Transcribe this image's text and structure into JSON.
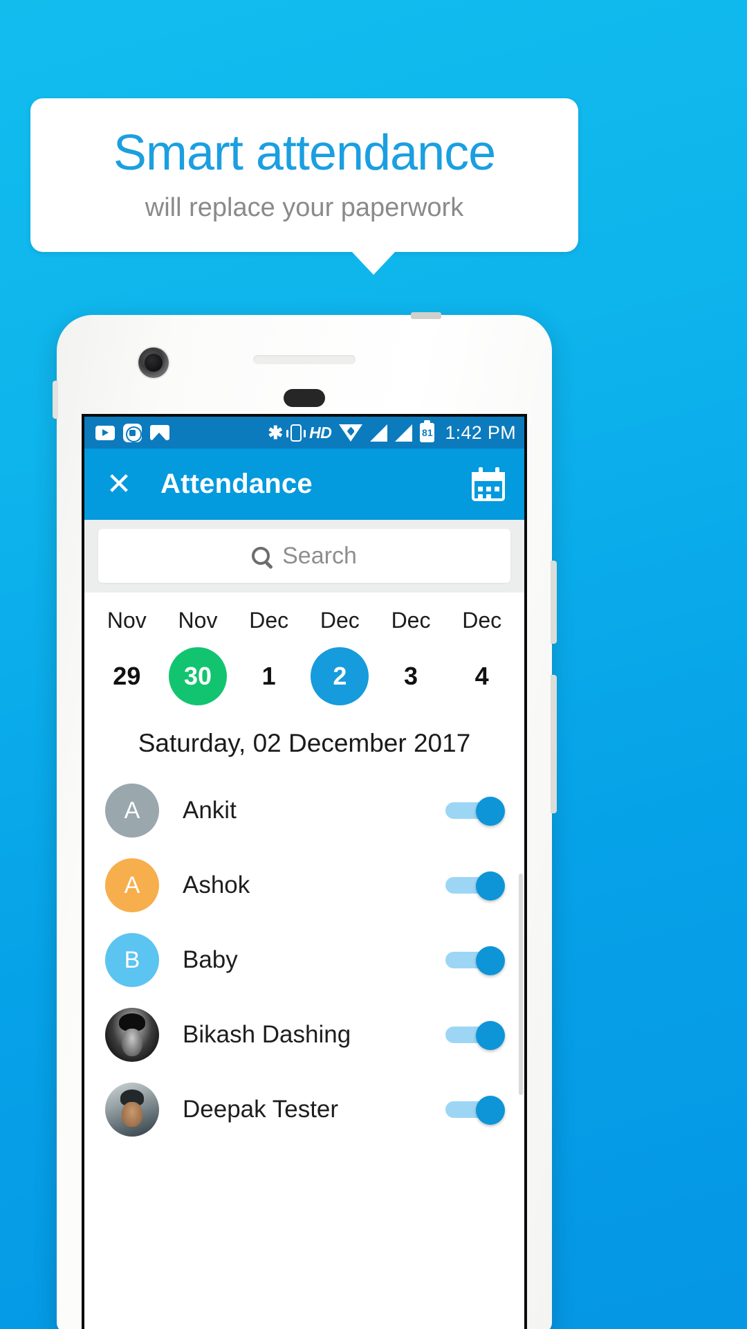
{
  "promo": {
    "title": "Smart attendance",
    "subtitle": "will replace your paperwork",
    "accent_blue": "#1b9fe0",
    "background_blue": "#06a2e8"
  },
  "status_bar": {
    "time": "1:42 PM",
    "battery_level": "81",
    "hd_label": "HD",
    "bluetooth_glyph": "✱",
    "left_icons": [
      "youtube-icon",
      "mi-account-icon",
      "gallery-icon"
    ],
    "right_icons": [
      "bluetooth-icon",
      "vibrate-icon",
      "hd-icon",
      "wifi-icon",
      "signal-icon-1",
      "signal-icon-2",
      "battery-icon"
    ]
  },
  "app_bar": {
    "close_label": "✕",
    "title": "Attendance",
    "calendar_icon": "calendar-icon",
    "background": "#049ade"
  },
  "search": {
    "placeholder": "Search",
    "icon": "search-icon"
  },
  "date_strip": [
    {
      "month": "Nov",
      "day": "29",
      "state": "normal"
    },
    {
      "month": "Nov",
      "day": "30",
      "state": "today"
    },
    {
      "month": "Dec",
      "day": "1",
      "state": "normal"
    },
    {
      "month": "Dec",
      "day": "2",
      "state": "selected"
    },
    {
      "month": "Dec",
      "day": "3",
      "state": "normal"
    },
    {
      "month": "Dec",
      "day": "4",
      "state": "normal"
    }
  ],
  "selected_date_label": "Saturday, 02 December 2017",
  "colors": {
    "today_green": "#12c46f",
    "selected_blue": "#169bdc",
    "toggle_on_knob": "#0d95d8",
    "toggle_on_track": "#9dd6f4"
  },
  "attendees": [
    {
      "name": "Ankit",
      "initial": "A",
      "avatar_type": "initial",
      "avatar_color": "#9aa7ad",
      "toggle": "on"
    },
    {
      "name": "Ashok",
      "initial": "A",
      "avatar_type": "initial",
      "avatar_color": "#f7ae4c",
      "toggle": "on"
    },
    {
      "name": "Baby",
      "initial": "B",
      "avatar_type": "initial",
      "avatar_color": "#5bc4f1",
      "toggle": "on"
    },
    {
      "name": "Bikash Dashing",
      "initial": "",
      "avatar_type": "photo",
      "avatar_color": "#1a1a1a",
      "toggle": "on"
    },
    {
      "name": "Deepak Tester",
      "initial": "",
      "avatar_type": "photo",
      "avatar_color": "#7a8a90",
      "toggle": "on"
    }
  ]
}
